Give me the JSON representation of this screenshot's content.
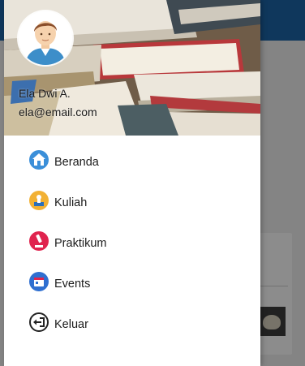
{
  "user": {
    "name": "Ela Dwi A.",
    "email": "ela@email.com"
  },
  "menu": {
    "items": [
      {
        "label": "Beranda",
        "icon": "home-icon"
      },
      {
        "label": "Kuliah",
        "icon": "kuliah-icon"
      },
      {
        "label": "Praktikum",
        "icon": "praktikum-icon"
      },
      {
        "label": "Events",
        "icon": "events-icon"
      },
      {
        "label": "Keluar",
        "icon": "logout-icon"
      }
    ]
  },
  "colors": {
    "appbar": "#1c65a8",
    "drawer_bg": "#ffffff",
    "scrim": "rgba(0,0,0,0.45)"
  }
}
